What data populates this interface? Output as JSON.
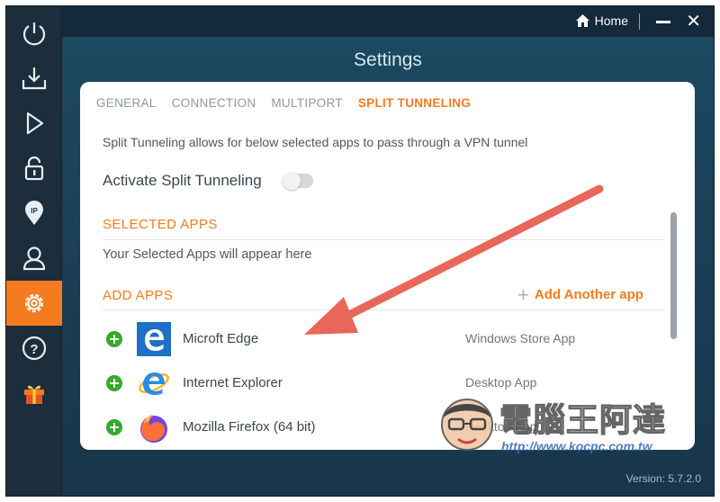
{
  "window": {
    "home_label": "Home",
    "page_title": "Settings",
    "version": "Version:  5.7.2.0"
  },
  "sidebar": {
    "items": [
      {
        "icon": "power-icon",
        "active": false
      },
      {
        "icon": "download-icon",
        "active": false
      },
      {
        "icon": "play-icon",
        "active": false
      },
      {
        "icon": "lock-icon",
        "active": false
      },
      {
        "icon": "ip-pin-icon",
        "active": false
      },
      {
        "icon": "user-icon",
        "active": false
      },
      {
        "icon": "gear-icon",
        "active": true
      },
      {
        "icon": "help-icon",
        "active": false
      },
      {
        "icon": "gift-icon",
        "active": false
      }
    ]
  },
  "tabs": [
    {
      "label": "GENERAL",
      "active": false
    },
    {
      "label": "CONNECTION",
      "active": false
    },
    {
      "label": "MULTIPORT",
      "active": false
    },
    {
      "label": "SPLIT TUNNELING",
      "active": true
    }
  ],
  "split": {
    "description": "Split Tunneling allows for below selected apps to pass through a VPN tunnel",
    "activate_label": "Activate Split Tunneling",
    "activate_on": false,
    "selected_heading": "SELECTED APPS",
    "selected_empty": "Your Selected Apps will appear here",
    "add_heading": "ADD APPS",
    "add_another_label": "Add Another app",
    "apps": [
      {
        "name": "Microft Edge",
        "type": "Windows Store App",
        "icon": "edge-icon"
      },
      {
        "name": "Internet Explorer",
        "type": "Desktop App",
        "icon": "ie-icon"
      },
      {
        "name": "Mozilla Firefox (64 bit)",
        "type": "Desktop App",
        "icon": "firefox-icon"
      }
    ]
  },
  "watermark": {
    "title": "電腦王阿達",
    "url": "http://www.kocpc.com.tw"
  },
  "colors": {
    "accent": "#f47b20",
    "sidebar": "#1c2d3b",
    "main_bg": "#1d4a62",
    "add_green": "#37a82f",
    "arrow": "#e8675a"
  }
}
